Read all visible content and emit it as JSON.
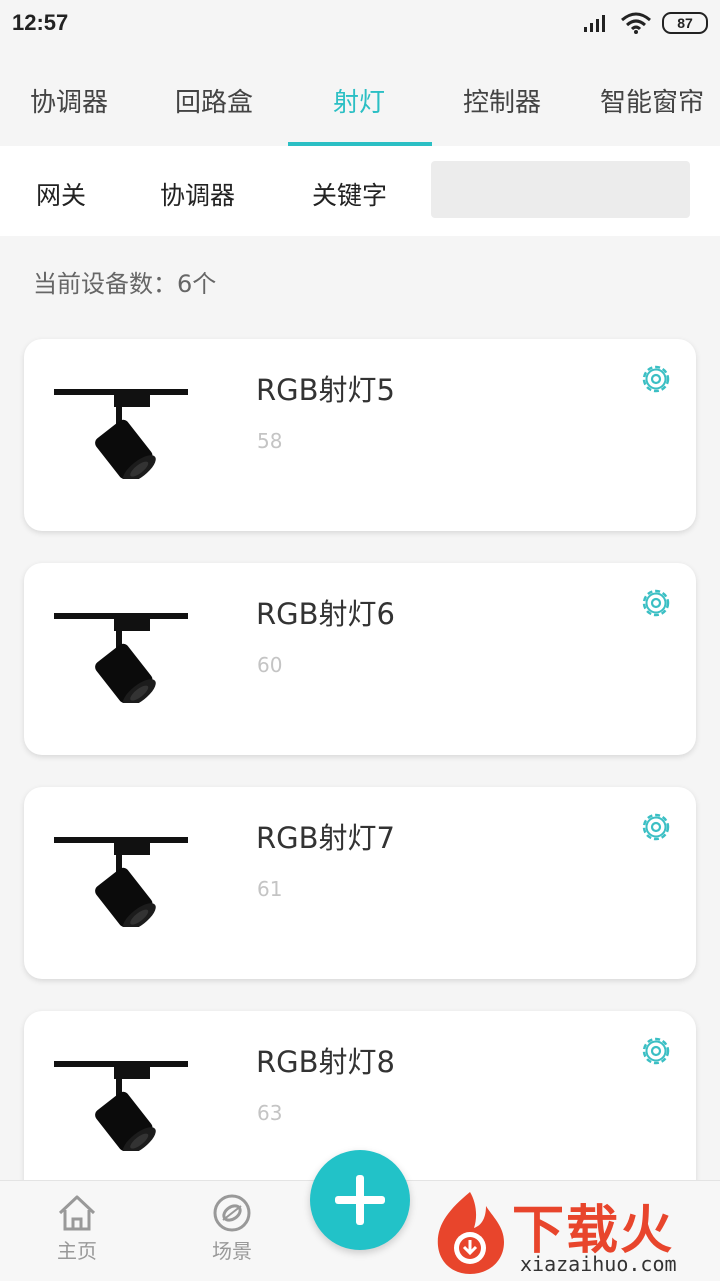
{
  "status_bar": {
    "time": "12:57",
    "battery": "87"
  },
  "tabs": [
    {
      "label": "协调器",
      "active": false
    },
    {
      "label": "回路盒",
      "active": false
    },
    {
      "label": "射灯",
      "active": true
    },
    {
      "label": "控制器",
      "active": false
    },
    {
      "label": "智能窗帘",
      "active": false
    }
  ],
  "filters": [
    {
      "label": "网关"
    },
    {
      "label": "协调器"
    },
    {
      "label": "关键字"
    }
  ],
  "search": {
    "placeholder": ""
  },
  "device_count": "当前设备数：6个",
  "devices": [
    {
      "name": "RGB射灯5",
      "id": "58"
    },
    {
      "name": "RGB射灯6",
      "id": "60"
    },
    {
      "name": "RGB射灯7",
      "id": "61"
    },
    {
      "name": "RGB射灯8",
      "id": "63"
    }
  ],
  "bottom_nav": [
    {
      "label": "主页",
      "icon": "home-icon"
    },
    {
      "label": "场景",
      "icon": "scene-icon"
    }
  ],
  "fab": {
    "icon": "plus-icon"
  },
  "watermark": {
    "text": "下载火",
    "url": "xiazaihuo.com"
  },
  "colors": {
    "accent": "#2bbfc4",
    "fab": "#22c2c8",
    "watermark": "#e8452c"
  }
}
